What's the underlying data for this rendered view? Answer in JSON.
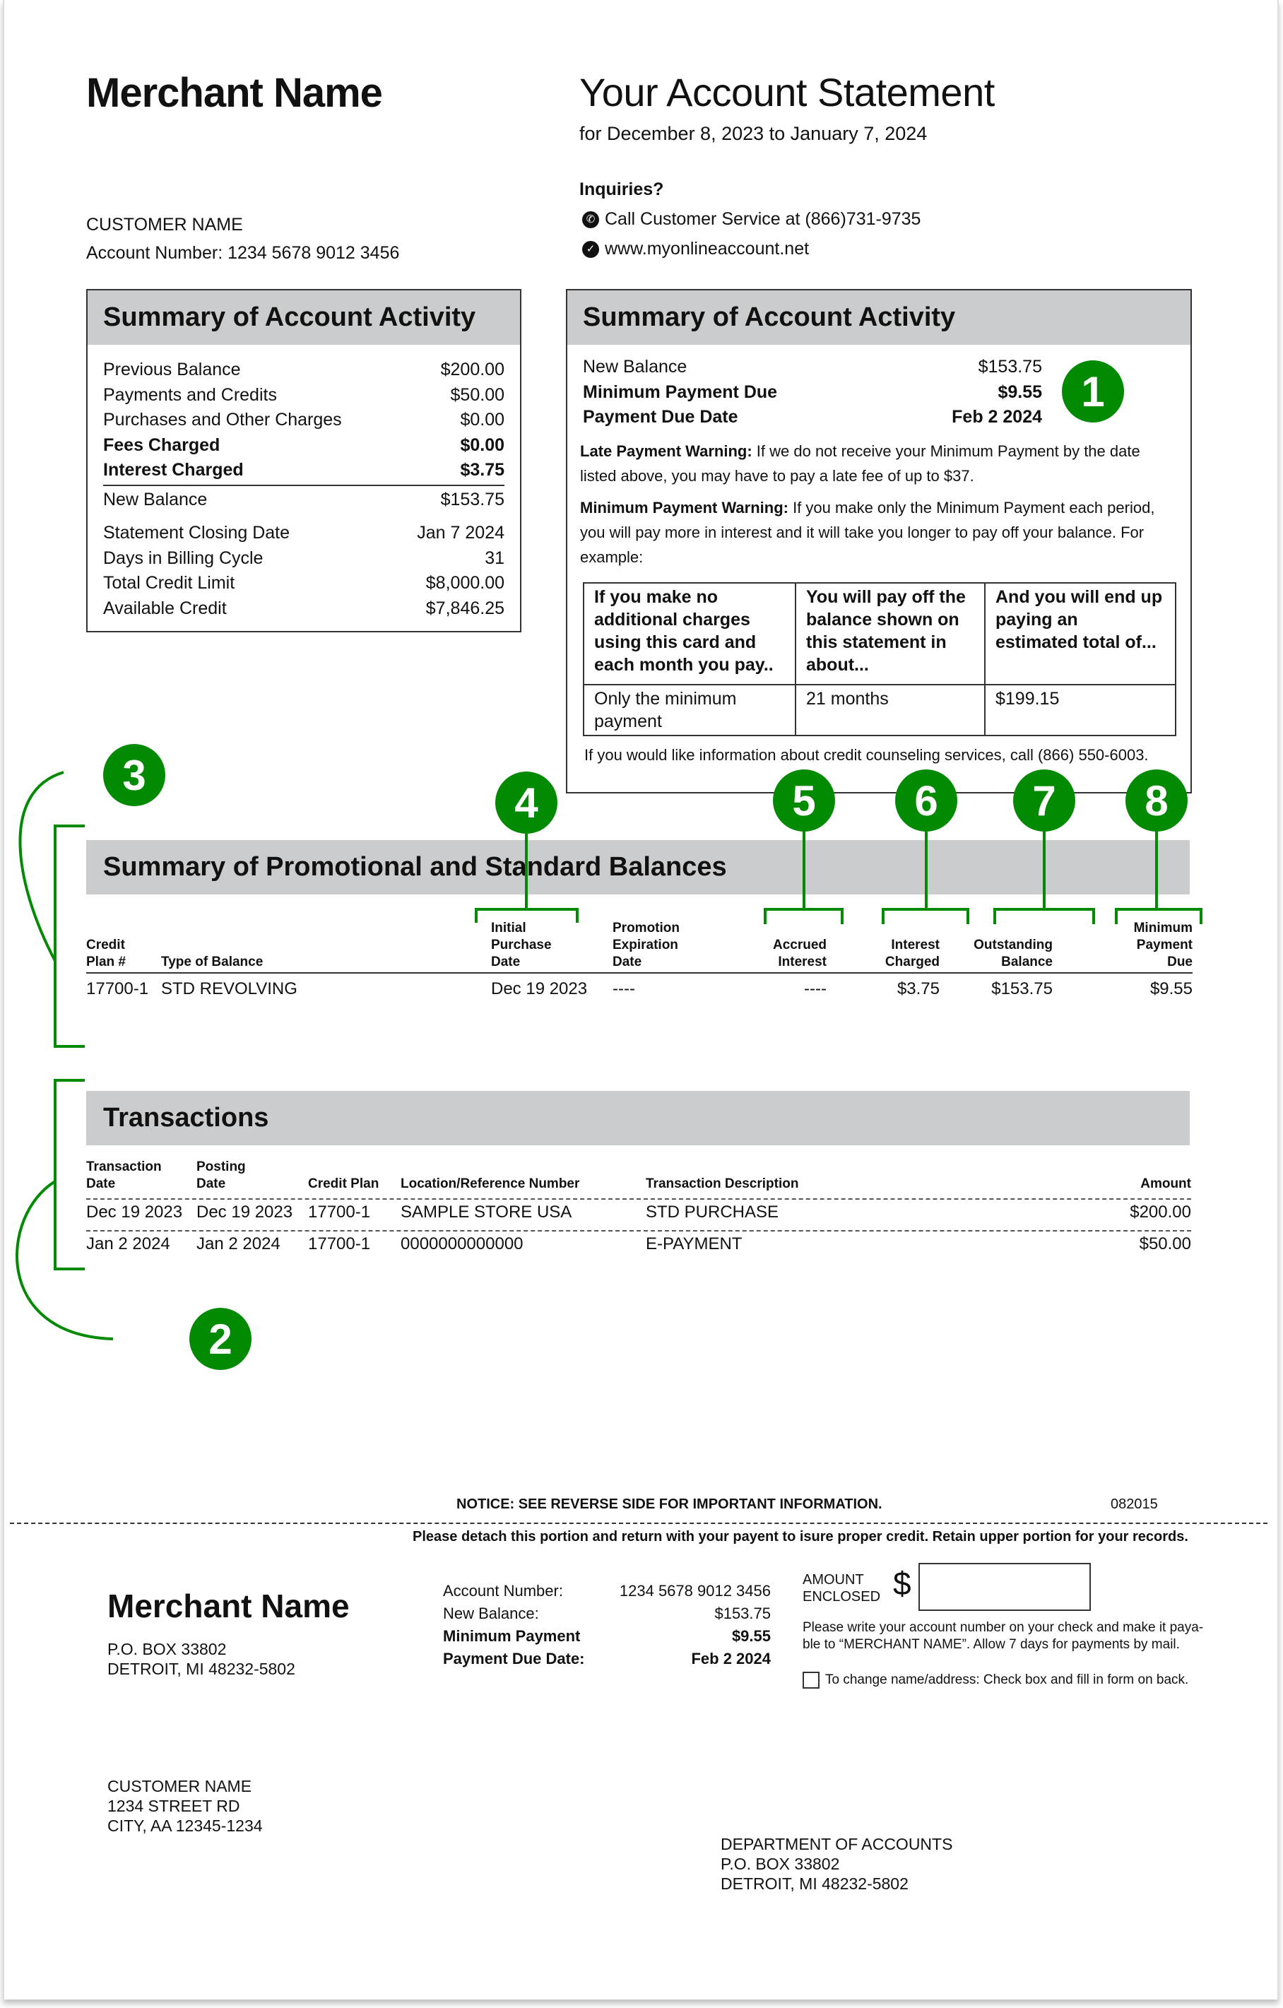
{
  "header": {
    "merchant_name": "Merchant Name",
    "title": "Your Account Statement",
    "period": "for December 8, 2023 to January 7, 2024",
    "inquiries_title": "Inquiries?",
    "phone_line": "Call Customer Service at (866)731-9735",
    "web_line": "www.myonlineaccount.net",
    "phone_icon": "phone-icon",
    "web_icon": "globe-icon"
  },
  "customer": {
    "name": "CUSTOMER NAME",
    "account_line": "Account Number: 1234 5678 9012 3456"
  },
  "summary_left": {
    "title": "Summary of Account Activity",
    "rows_top": [
      {
        "label": "Previous Balance",
        "value": "$200.00",
        "bold": false
      },
      {
        "label": "Payments and Credits",
        "value": "$50.00",
        "bold": false
      },
      {
        "label": "Purchases and Other Charges",
        "value": "$0.00",
        "bold": false
      },
      {
        "label": "Fees Charged",
        "value": "$0.00",
        "bold": true
      },
      {
        "label": "Interest Charged",
        "value": "$3.75",
        "bold": true
      }
    ],
    "new_balance": {
      "label": "New Balance",
      "value": "$153.75"
    },
    "rows_bottom": [
      {
        "label": "Statement Closing Date",
        "value": "Jan 7 2024"
      },
      {
        "label": "Days in Billing Cycle",
        "value": "31"
      },
      {
        "label": "Total Credit Limit",
        "value": "$8,000.00"
      },
      {
        "label": "Available Credit",
        "value": "$7,846.25"
      }
    ]
  },
  "summary_right": {
    "title": "Summary of Account Activity",
    "new_balance": {
      "label": "New Balance",
      "value": "$153.75"
    },
    "minimum_payment": {
      "label": "Minimum Payment Due",
      "value": "$9.55"
    },
    "due_date": {
      "label": "Payment Due Date",
      "value": "Feb 2 2024"
    },
    "late_warning_label": "Late Payment Warning:",
    "late_warning_text": " If we do not receive your Minimum Payment by the date listed above, you may have to pay a late fee of up to $37.",
    "min_warning_label": "Minimum Payment Warning:",
    "min_warning_text": " If you make only the Minimum Payment each period, you will pay more in interest and it will take you longer to pay off your balance. For example:",
    "table_headers": [
      "If you make no additional charges using this card and each month you pay..",
      "You will pay off the balance shown on this statement in about...",
      "And you will end up paying an estimated total of..."
    ],
    "table_row": [
      "Only the minimum payment",
      "21 months",
      "$199.15"
    ],
    "counseling": "If you would like information about credit counseling services, call (866) 550-6003."
  },
  "callouts": [
    "1",
    "2",
    "3",
    "4",
    "5",
    "6",
    "7",
    "8"
  ],
  "callout_color": "#038a03",
  "promo": {
    "title": "Summary of Promotional and Standard Balances",
    "headers": [
      "Credit Plan #",
      "Type of Balance",
      "Initial Purchase Date",
      "Promotion Expiration Date",
      "Accrued Interest",
      "Interest Charged",
      "Outstanding Balance",
      "Minimum Payment Due"
    ],
    "rows": [
      [
        "17700-1",
        "STD REVOLVING",
        "Dec 19 2023",
        "----",
        "----",
        "$3.75",
        "$153.75",
        "$9.55"
      ]
    ]
  },
  "transactions": {
    "title": "Transactions",
    "headers": [
      "Transaction Date",
      "Posting Date",
      "Credit Plan",
      "Location/Reference Number",
      "Transaction Description",
      "Amount"
    ],
    "rows": [
      [
        "Dec 19 2023",
        "Dec 19 2023",
        "17700-1",
        "SAMPLE STORE USA",
        "STD PURCHASE",
        "$200.00"
      ],
      [
        "Jan 2 2024",
        "Jan 2 2024",
        "17700-1",
        "0000000000000",
        "E-PAYMENT",
        "$50.00"
      ]
    ]
  },
  "footer": {
    "notice": "NOTICE: SEE REVERSE SIDE FOR IMPORTANT INFORMATION.",
    "code": "082015",
    "detach": "Please detach this portion and return with your payent to isure proper credit. Retain upper portion for your records."
  },
  "remit": {
    "merchant_name": "Merchant Name",
    "merchant_address": [
      "P.O. BOX 33802",
      "DETROIT, MI 48232-5802"
    ],
    "rows": [
      {
        "label": "Account Number:",
        "value": "1234 5678 9012 3456",
        "bold": false
      },
      {
        "label": "New Balance:",
        "value": "$153.75",
        "bold": false
      },
      {
        "label": "Minimum Payment",
        "value": "$9.55",
        "bold": true
      },
      {
        "label": "Payment Due Date:",
        "value": "Feb 2 2024",
        "bold": true
      }
    ],
    "amount_label_1": "AMOUNT",
    "amount_label_2": "ENCLOSED",
    "dollar": "$",
    "amount_value": "",
    "instructions": "Please write your account number on your check and make it paya-ble to “MERCHANT NAME”. Allow 7 days for payments by mail.",
    "change_address_label": "To change name/address: Check box and fill in form on back.",
    "customer_address": [
      "CUSTOMER NAME",
      "1234 STREET RD",
      "CITY, AA 12345-1234"
    ],
    "department_address": [
      "DEPARTMENT OF ACCOUNTS",
      "P.O. BOX 33802",
      "DETROIT, MI 48232-5802"
    ]
  }
}
